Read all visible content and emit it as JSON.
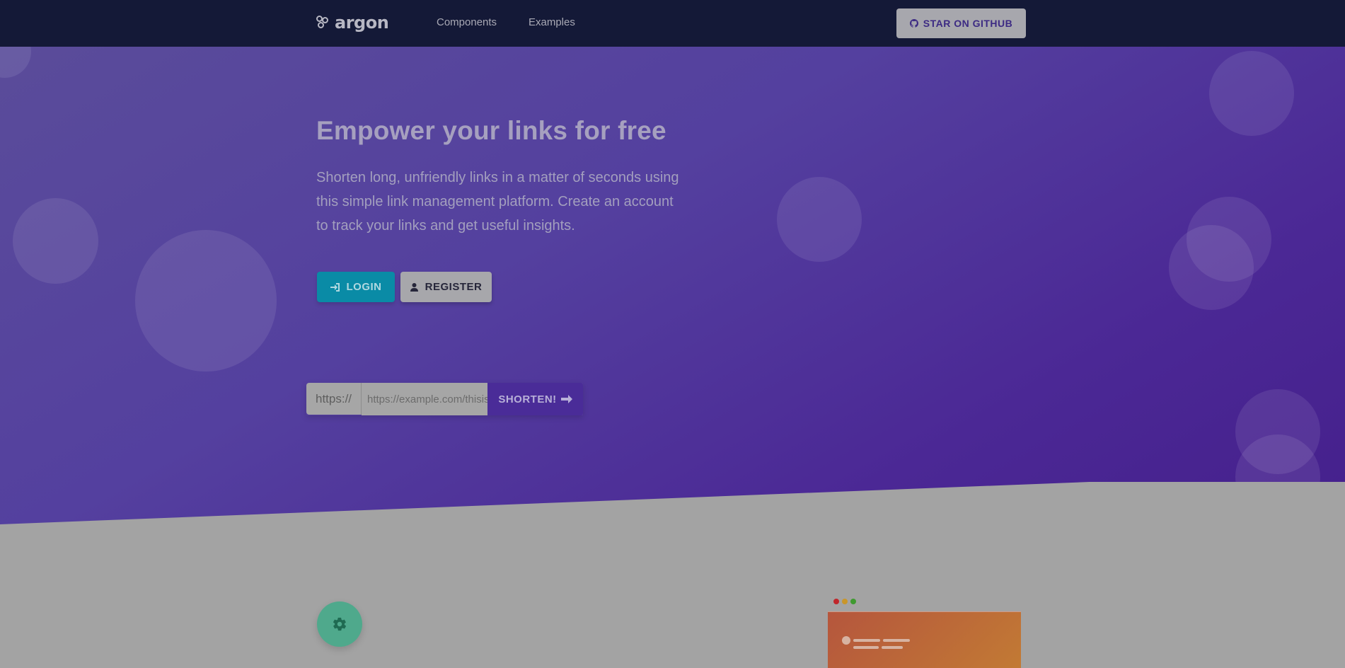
{
  "navbar": {
    "brand": "argon",
    "links": [
      "Components",
      "Examples"
    ],
    "github_label": "STAR ON GITHUB"
  },
  "hero": {
    "title": "Empower your links for free",
    "description": "Shorten long, unfriendly links in a matter of seconds using this simple link management platform. Create an account to track your links and get useful insights.",
    "login_label": "LOGIN",
    "register_label": "REGISTER"
  },
  "shortener": {
    "prefix": "https://",
    "placeholder": "https://example.com/thisisalongurl",
    "button_label": "SHORTEN!"
  },
  "colors": {
    "navbar": "#141937",
    "hero_start": "#5a4c9a",
    "hero_end": "#45208c",
    "login": "#0a8ba6",
    "shorten": "#4a2c98",
    "gear": "#4fa98c",
    "preview": "#c27a34"
  },
  "icons": {
    "brand": "argon-logo-icon",
    "github": "github-icon",
    "login": "sign-in-icon",
    "register": "user-icon",
    "shorten": "send-icon",
    "settings": "gear-icon"
  }
}
